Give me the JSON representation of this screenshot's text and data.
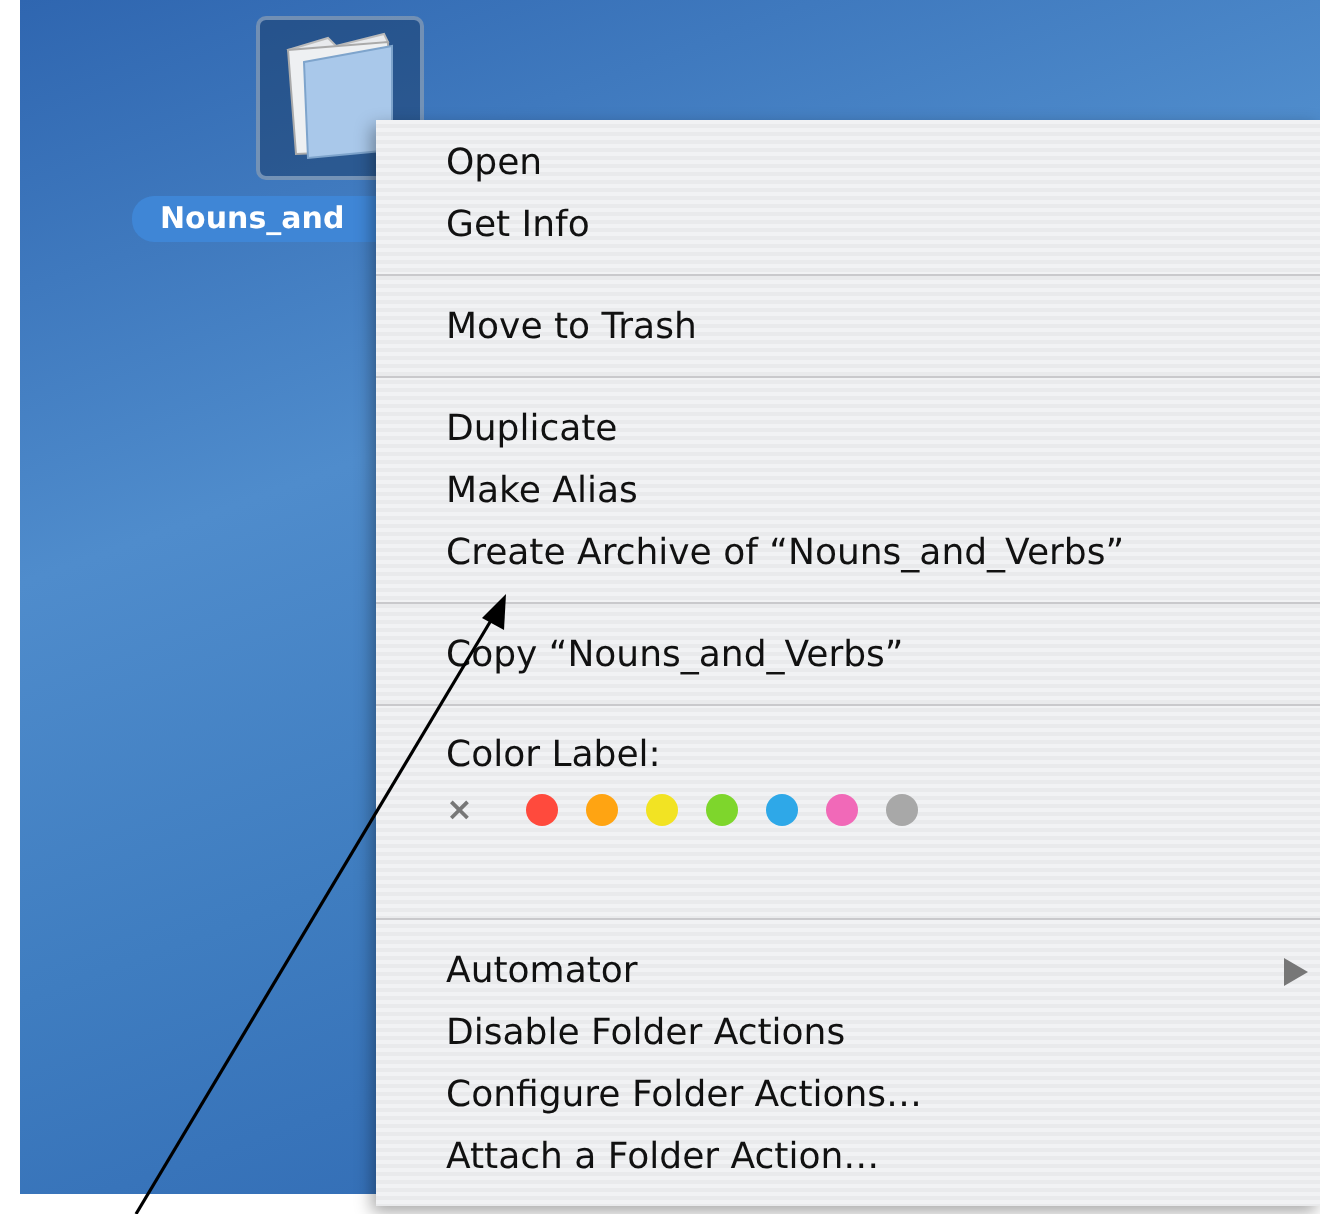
{
  "desktop": {
    "folder": {
      "label": "Nouns_and"
    }
  },
  "context_menu": {
    "groups": [
      {
        "kind": "items",
        "items": [
          {
            "label": "Open",
            "submenu": false
          },
          {
            "label": "Get Info",
            "submenu": false
          }
        ]
      },
      {
        "kind": "items",
        "items": [
          {
            "label": "Move to Trash",
            "submenu": false
          }
        ]
      },
      {
        "kind": "items",
        "items": [
          {
            "label": "Duplicate",
            "submenu": false
          },
          {
            "label": "Make Alias",
            "submenu": false
          },
          {
            "label": "Create Archive of “Nouns_and_Verbs”",
            "submenu": false
          }
        ]
      },
      {
        "kind": "items",
        "items": [
          {
            "label": "Copy “Nouns_and_Verbs”",
            "submenu": false
          }
        ]
      },
      {
        "kind": "colors",
        "title": "Color Label:",
        "options": [
          {
            "kind": "none",
            "symbol": "×"
          },
          {
            "kind": "color",
            "color": "#ff4a3d"
          },
          {
            "kind": "color",
            "color": "#ffa412"
          },
          {
            "kind": "color",
            "color": "#f2e323"
          },
          {
            "kind": "color",
            "color": "#7ed62c"
          },
          {
            "kind": "color",
            "color": "#2ea8e8"
          },
          {
            "kind": "color",
            "color": "#f169b8"
          },
          {
            "kind": "color",
            "color": "#a8a8a8"
          }
        ]
      },
      {
        "kind": "items",
        "items": [
          {
            "label": "Automator",
            "submenu": true
          },
          {
            "label": "Disable Folder Actions",
            "submenu": false
          },
          {
            "label": "Configure Folder Actions…",
            "submenu": false
          },
          {
            "label": "Attach a Folder Action…",
            "submenu": false
          }
        ]
      }
    ]
  }
}
